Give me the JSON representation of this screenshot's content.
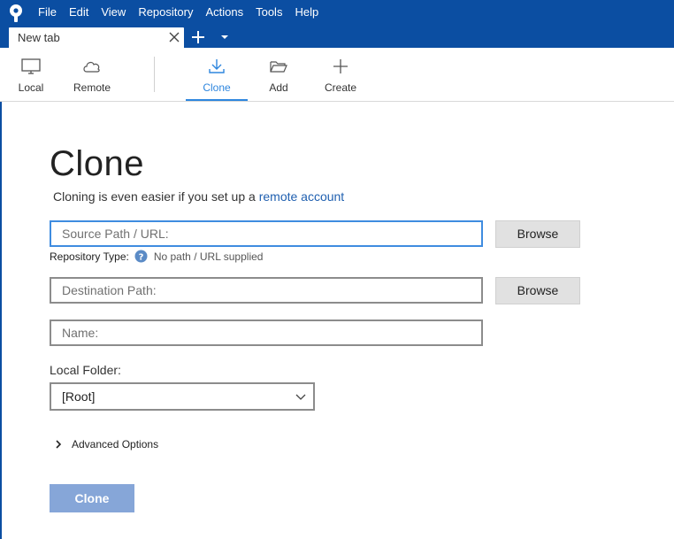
{
  "menu": [
    "File",
    "Edit",
    "View",
    "Repository",
    "Actions",
    "Tools",
    "Help"
  ],
  "tab": {
    "title": "New tab"
  },
  "toolbar": {
    "local_label": "Local",
    "remote_label": "Remote",
    "clone_label": "Clone",
    "add_label": "Add",
    "create_label": "Create",
    "active": "Clone"
  },
  "main": {
    "title": "Clone",
    "subtitle_text": "Cloning is even easier if you set up a ",
    "subtitle_link": "remote account",
    "source": {
      "placeholder": "Source Path / URL:",
      "value": ""
    },
    "browse_label": "Browse",
    "repo_type_label": "Repository Type:",
    "repo_type_value": "No path / URL supplied",
    "destination": {
      "placeholder": "Destination Path:",
      "value": ""
    },
    "name": {
      "placeholder": "Name:",
      "value": ""
    },
    "local_folder_label": "Local Folder:",
    "local_folder_value": "[Root]",
    "advanced_label": "Advanced Options",
    "clone_button": "Clone"
  },
  "colors": {
    "titlebar": "#0b4ea2",
    "accent": "#2e86de",
    "clone_button_disabled": "#86a6d8",
    "link": "#2060b0"
  },
  "icons": {
    "app": "sourcetree-logo-icon",
    "tab_close": "close-icon",
    "new_tab": "plus-icon",
    "tab_menu": "caret-down-icon",
    "local": "monitor-icon",
    "remote": "cloud-icon",
    "clone": "download-icon",
    "add": "folder-open-icon",
    "create": "plus-icon",
    "help": "question-circle-icon",
    "select": "chevron-down-icon",
    "advanced": "chevron-right-icon"
  }
}
